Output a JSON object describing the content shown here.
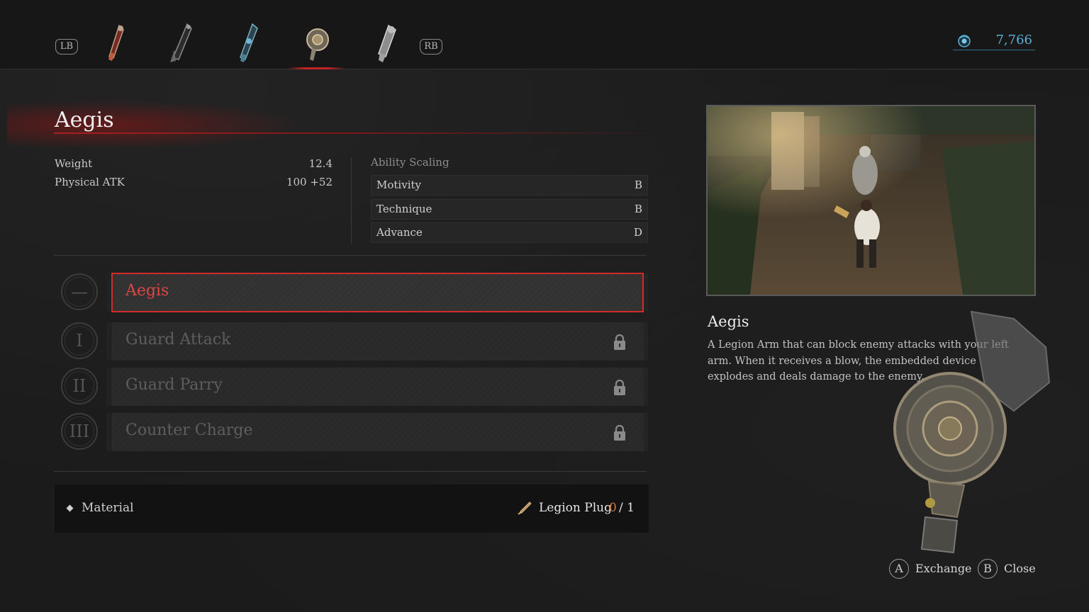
{
  "topbar": {
    "left_shoulder": "LB",
    "right_shoulder": "RB",
    "tabs": [
      {
        "icon": "red-arm-icon",
        "active": false
      },
      {
        "icon": "dark-blade-arm-icon",
        "active": false
      },
      {
        "icon": "blue-arm-icon",
        "active": false
      },
      {
        "icon": "aegis-shield-arm-icon",
        "active": true
      },
      {
        "icon": "silver-arm-icon",
        "active": false
      }
    ],
    "currency": {
      "icon": "ergo-icon",
      "value": "7,766"
    }
  },
  "item": {
    "name": "Aegis",
    "stats": [
      {
        "label": "Weight",
        "value": "12.4"
      },
      {
        "label": "Physical ATK",
        "value": "100 +52"
      }
    ],
    "ability_scaling": {
      "title": "Ability Scaling",
      "rows": [
        {
          "label": "Motivity",
          "grade": "B"
        },
        {
          "label": "Technique",
          "grade": "B"
        },
        {
          "label": "Advance",
          "grade": "D"
        }
      ]
    }
  },
  "skills": [
    {
      "tier": "—",
      "name": "Aegis",
      "locked": false,
      "selected": true
    },
    {
      "tier": "I",
      "name": "Guard Attack",
      "locked": true,
      "selected": false
    },
    {
      "tier": "II",
      "name": "Guard Parry",
      "locked": true,
      "selected": false
    },
    {
      "tier": "III",
      "name": "Counter Charge",
      "locked": true,
      "selected": false
    }
  ],
  "material": {
    "label": "Material",
    "item_name": "Legion Plug",
    "have": "0",
    "need": "/ 1"
  },
  "description": {
    "title": "Aegis",
    "text": "A Legion Arm that can block enemy attacks with your left arm. When it receives a blow, the embedded device explodes and deals damage to the enemy."
  },
  "hints": [
    {
      "button": "A",
      "label": "Exchange"
    },
    {
      "button": "B",
      "label": "Close"
    }
  ],
  "colors": {
    "accent_red": "#d12b2b",
    "currency_blue": "#5eb1d6",
    "material_count": "#d07a38"
  }
}
